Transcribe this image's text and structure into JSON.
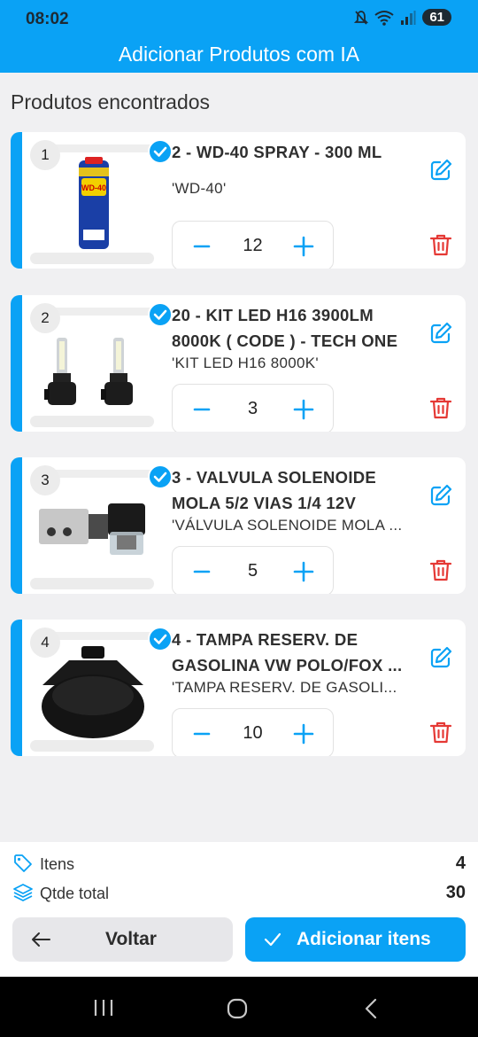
{
  "status_bar": {
    "time": "08:02",
    "battery": "61",
    "icons": [
      "mute-icon",
      "wifi-icon",
      "signal-icon"
    ]
  },
  "app_bar": {
    "title": "Adicionar Produtos com IA"
  },
  "section_title": "Produtos encontrados",
  "products": [
    {
      "index": "1",
      "title": "2 - WD-40 SPRAY - 300 ML",
      "code": "'WD-40'",
      "quantity": "12",
      "image": "wd40-spray-can"
    },
    {
      "index": "2",
      "title": "20 - KIT LED  H16 3900LM 8000K ( CODE ) - TECH ONE",
      "code": "'KIT LED H16 8000K'",
      "quantity": "3",
      "image": "led-bulb-pair"
    },
    {
      "index": "3",
      "title": "3 - VALVULA SOLENOIDE MOLA 5/2 VIAS 1/4 12V",
      "code": "'VÁLVULA SOLENOIDE MOLA ...",
      "quantity": "5",
      "image": "solenoid-valve"
    },
    {
      "index": "4",
      "title": "4 - TAMPA RESERV. DE GASOLINA VW POLO/FOX ...",
      "code": "'TAMPA RESERV. DE GASOLI...",
      "quantity": "10",
      "image": "fuel-reservoir-cap"
    }
  ],
  "summary": {
    "items_label": "Itens",
    "items_value": "4",
    "total_label": "Qtde total",
    "total_value": "30"
  },
  "buttons": {
    "back_label": "Voltar",
    "add_label": "Adicionar itens"
  },
  "colors": {
    "primary": "#0aa2f5",
    "delete": "#e53935",
    "background": "#f0f0f2"
  }
}
